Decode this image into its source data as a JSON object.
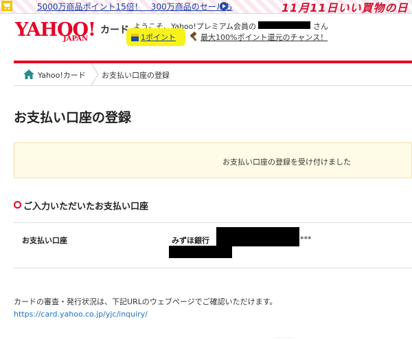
{
  "banner": {
    "text": "5000万商品ポイント15倍！　300万商品のセールも",
    "sale_title": "11月11日いい買物の日"
  },
  "header": {
    "logo_yahoo": "YAHOO!",
    "logo_japan": "JAPAN",
    "logo_card": "カード",
    "welcome": "ようこそ、Yahoo!プレミアム会員の",
    "honorific": "さん",
    "points": "1ポイント",
    "chance": "最大100%ポイント還元のチャンス！"
  },
  "breadcrumb": {
    "home": "Yahoo!カード",
    "current": "お支払い口座の登録"
  },
  "main": {
    "title": "お支払い口座の登録",
    "notice": "お支払い口座の登録を受け付けました",
    "section_heading": "ご入力いただいたお支払い口座",
    "row_label": "お支払い口座",
    "bank_name": "みずほ銀行",
    "account_mask": "***",
    "info": "カードの審査・発行状況は、下記URLのウェブページでご確認いただけます。",
    "link": "https://card.yahoo.co.jp/yjc/inquiry/"
  },
  "colors": {
    "brand_red": "#e60026",
    "link_blue": "#1a73c8",
    "highlight_yellow": "#f7f21a"
  },
  "icons": [
    "cart-icon",
    "play-icon",
    "tpoint-icon",
    "hammer-icon",
    "home-icon",
    "chevron-right-icon"
  ]
}
